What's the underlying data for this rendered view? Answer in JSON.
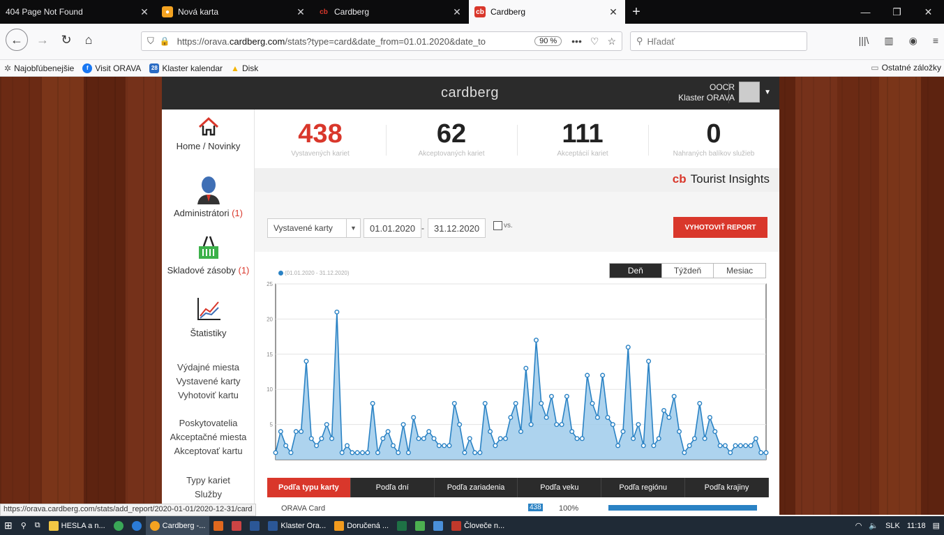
{
  "browser": {
    "tabs": [
      {
        "title": "404 Page Not Found",
        "active": false
      },
      {
        "title": "Nová karta",
        "active": false
      },
      {
        "title": "Cardberg",
        "active": false
      },
      {
        "title": "Cardberg",
        "active": true
      }
    ],
    "url_prefix": "https://orava.",
    "url_domain": "cardberg.com",
    "url_rest": "/stats?type=card&date_from=01.01.2020&date_to",
    "zoom": "90 %",
    "search_placeholder": "Hľadať",
    "bookmarks": [
      "Najobľúbenejšie",
      "Visit ORAVA",
      "Klaster kalendar",
      "Disk"
    ],
    "bookmarks_other": "Ostatné záložky",
    "status_url": "https://orava.cardberg.com/stats/add_report/2020-01-01/2020-12-31/card"
  },
  "app": {
    "logo": "cardberg",
    "user_line1": "OOCR",
    "user_line2": "Klaster ORAVA"
  },
  "sidebar": {
    "home": "Home / Novinky",
    "admins": "Administrátori",
    "admins_count": "(1)",
    "stock": "Skladové zásoby",
    "stock_count": "(1)",
    "stats": "Štatistiky",
    "group1": [
      "Výdajné miesta",
      "Vystavené karty",
      "Vyhotoviť kartu"
    ],
    "group2": [
      "Poskytovatelia",
      "Akceptačné miesta",
      "Akceptovať kartu"
    ],
    "group3": [
      "Typy kariet",
      "Služby"
    ]
  },
  "stats": [
    {
      "value": "438",
      "label": "Vystavených kariet"
    },
    {
      "value": "62",
      "label": "Akceptovaných kariet"
    },
    {
      "value": "111",
      "label": "Akceptácií kariet"
    },
    {
      "value": "0",
      "label": "Nahraných balíkov služieb"
    }
  ],
  "insights_brand": "Tourist Insights",
  "filters": {
    "type": "Vystavené karty",
    "date_from": "01.01.2020",
    "date_to": "31.12.2020",
    "vs": "vs.",
    "report_button": "VYHOTOVIŤ REPORT"
  },
  "period_tabs": [
    "Deň",
    "Týždeň",
    "Mesiac"
  ],
  "colors": {
    "accent": "#d9372b",
    "series": "#2a82c4",
    "fill": "#9fcbeb"
  },
  "chart_data": {
    "type": "area",
    "title": "",
    "series": [
      {
        "name": "(01.01.2020 - 31.12.2020)",
        "values": [
          1,
          4,
          2,
          1,
          4,
          4,
          14,
          3,
          2,
          3,
          5,
          3,
          21,
          1,
          2,
          1,
          1,
          1,
          1,
          8,
          1,
          3,
          4,
          2,
          1,
          5,
          1,
          6,
          3,
          3,
          4,
          3,
          2,
          2,
          2,
          8,
          5,
          1,
          3,
          1,
          1,
          8,
          4,
          2,
          3,
          3,
          6,
          8,
          4,
          13,
          5,
          17,
          8,
          6,
          9,
          5,
          5,
          9,
          4,
          3,
          3,
          12,
          8,
          6,
          12,
          6,
          5,
          2,
          4,
          16,
          3,
          5,
          2,
          14,
          2,
          3,
          7,
          6,
          9,
          4,
          1,
          2,
          3,
          8,
          3,
          6,
          4,
          2,
          2,
          1,
          2,
          2,
          2,
          2,
          3,
          1,
          1
        ]
      }
    ],
    "ylim": [
      0,
      25
    ],
    "yticks": [
      5,
      10,
      15,
      20,
      25
    ],
    "grid": true
  },
  "bottom_tabs": [
    "Podľa typu karty",
    "Podľa dní",
    "Podľa zariadenia",
    "Podľa veku",
    "Podľa regiónu",
    "Podľa krajiny"
  ],
  "table_row": {
    "name": "ORAVA Card",
    "count": "438",
    "percent": "100%"
  },
  "taskbar": {
    "items": [
      "HESLA a n...",
      "Cardberg -...",
      "Klaster Ora...",
      "Doručená ...",
      "Človeče n..."
    ],
    "lang": "SLK",
    "time": "11:18"
  }
}
